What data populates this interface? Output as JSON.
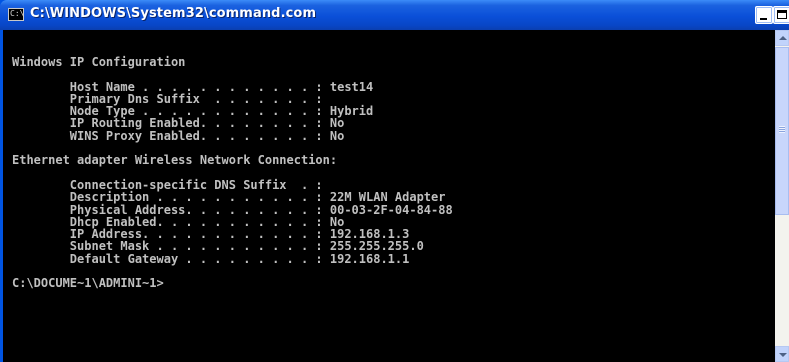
{
  "window": {
    "title": "C:\\WINDOWS\\System32\\command.com",
    "icon_text": "C:\\",
    "colors": {
      "titlebar": "#0a4fd8",
      "console_bg": "#000000",
      "console_fg": "#c0c0c0"
    }
  },
  "console": {
    "lines": [
      "Windows IP Configuration",
      "",
      "        Host Name . . . . . . . . . . . . : test14",
      "        Primary Dns Suffix  . . . . . . . :",
      "        Node Type . . . . . . . . . . . . : Hybrid",
      "        IP Routing Enabled. . . . . . . . : No",
      "        WINS Proxy Enabled. . . . . . . . : No",
      "",
      "Ethernet adapter Wireless Network Connection:",
      "",
      "        Connection-specific DNS Suffix  . :",
      "        Description . . . . . . . . . . . : 22M WLAN Adapter",
      "        Physical Address. . . . . . . . . : 00-03-2F-04-84-88",
      "        Dhcp Enabled. . . . . . . . . . . : No",
      "        IP Address. . . . . . . . . . . . : 192.168.1.3",
      "        Subnet Mask . . . . . . . . . . . : 255.255.255.0",
      "        Default Gateway . . . . . . . . . : 192.168.1.1",
      "",
      "C:\\DOCUME~1\\ADMINI~1>"
    ]
  }
}
